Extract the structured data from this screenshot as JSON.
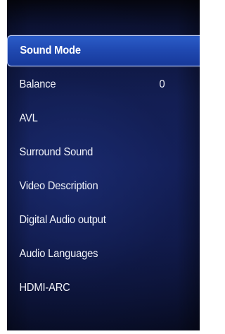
{
  "menu": {
    "items": [
      {
        "label": "Sound Mode",
        "value": "",
        "selected": true
      },
      {
        "label": "Balance",
        "value": "0",
        "selected": false
      },
      {
        "label": "AVL",
        "value": "",
        "selected": false
      },
      {
        "label": "Surround Sound",
        "value": "",
        "selected": false
      },
      {
        "label": "Video Description",
        "value": "",
        "selected": false
      },
      {
        "label": "Digital Audio output",
        "value": "",
        "selected": false
      },
      {
        "label": "Audio Languages",
        "value": "",
        "selected": false
      },
      {
        "label": "HDMI-ARC",
        "value": "",
        "selected": false
      }
    ]
  },
  "colors": {
    "background": "#141f55",
    "highlight": "#1f48b0",
    "highlight_border": "#c9d8ff",
    "text": "#f2f4fa"
  }
}
